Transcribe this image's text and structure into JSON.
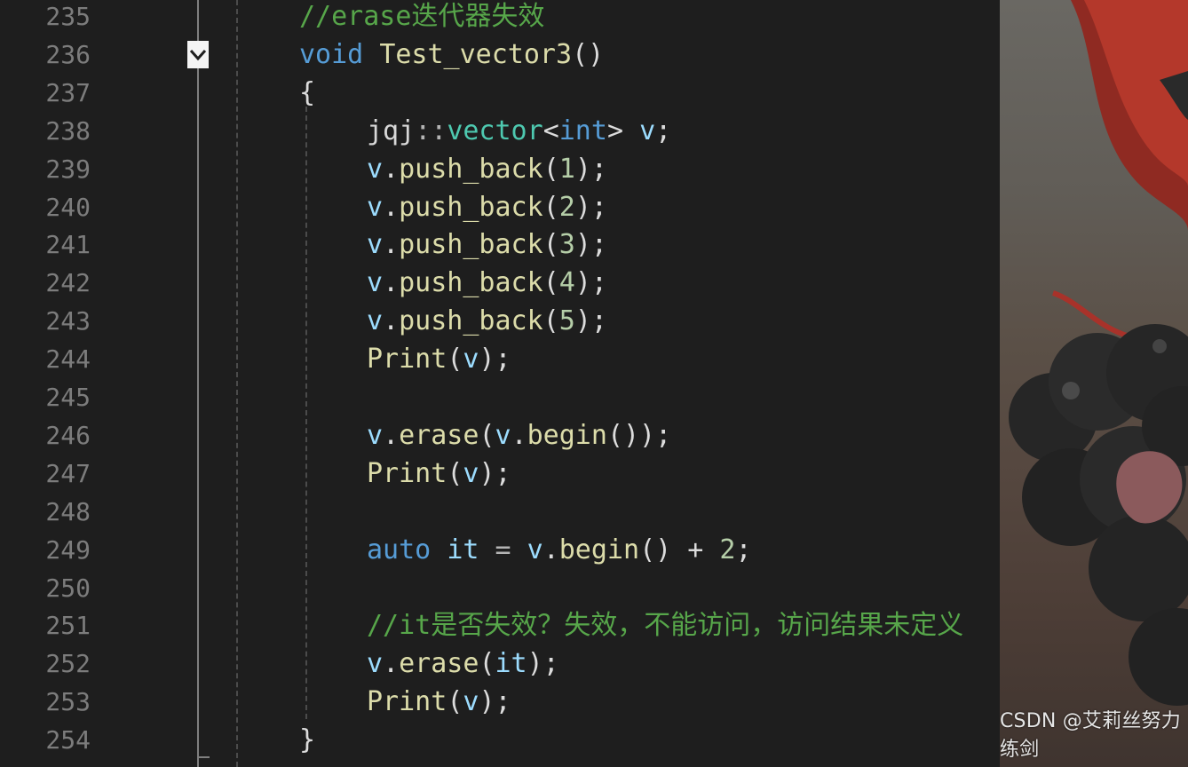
{
  "theme": {
    "background": "#1e1e1e",
    "line_number": "#7c7c7c",
    "keyword": "#569cd6",
    "type": "#4ec9b0",
    "function": "#dcdcaa",
    "variable": "#9cdcfe",
    "number": "#b5cea8",
    "comment": "#57a64a",
    "punctuation": "#dcdcdc",
    "namespace": "#d8d8d8",
    "operator": "#b4b4b4"
  },
  "editor": {
    "fold_icon": "chevron-down-icon",
    "lines": [
      {
        "num": "235",
        "indent": 0,
        "tokens": [
          {
            "t": "//erase迭代器失效",
            "k": "comment"
          }
        ]
      },
      {
        "num": "236",
        "indent": 0,
        "tokens": [
          {
            "t": "void",
            "k": "keyword"
          },
          {
            "t": " ",
            "k": "punctuation"
          },
          {
            "t": "Test_vector3",
            "k": "function"
          },
          {
            "t": "()",
            "k": "punctuation"
          }
        ]
      },
      {
        "num": "237",
        "indent": 0,
        "tokens": [
          {
            "t": "{",
            "k": "punctuation"
          }
        ]
      },
      {
        "num": "238",
        "indent": 1,
        "tokens": [
          {
            "t": "jqj",
            "k": "namespace"
          },
          {
            "t": "::",
            "k": "operator"
          },
          {
            "t": "vector",
            "k": "type"
          },
          {
            "t": "<",
            "k": "punctuation"
          },
          {
            "t": "int",
            "k": "keyword"
          },
          {
            "t": "> ",
            "k": "punctuation"
          },
          {
            "t": "v",
            "k": "variable"
          },
          {
            "t": ";",
            "k": "punctuation"
          }
        ]
      },
      {
        "num": "239",
        "indent": 1,
        "tokens": [
          {
            "t": "v",
            "k": "variable"
          },
          {
            "t": ".",
            "k": "punctuation"
          },
          {
            "t": "push_back",
            "k": "function"
          },
          {
            "t": "(",
            "k": "punctuation"
          },
          {
            "t": "1",
            "k": "number"
          },
          {
            "t": ");",
            "k": "punctuation"
          }
        ]
      },
      {
        "num": "240",
        "indent": 1,
        "tokens": [
          {
            "t": "v",
            "k": "variable"
          },
          {
            "t": ".",
            "k": "punctuation"
          },
          {
            "t": "push_back",
            "k": "function"
          },
          {
            "t": "(",
            "k": "punctuation"
          },
          {
            "t": "2",
            "k": "number"
          },
          {
            "t": ");",
            "k": "punctuation"
          }
        ]
      },
      {
        "num": "241",
        "indent": 1,
        "tokens": [
          {
            "t": "v",
            "k": "variable"
          },
          {
            "t": ".",
            "k": "punctuation"
          },
          {
            "t": "push_back",
            "k": "function"
          },
          {
            "t": "(",
            "k": "punctuation"
          },
          {
            "t": "3",
            "k": "number"
          },
          {
            "t": ");",
            "k": "punctuation"
          }
        ]
      },
      {
        "num": "242",
        "indent": 1,
        "tokens": [
          {
            "t": "v",
            "k": "variable"
          },
          {
            "t": ".",
            "k": "punctuation"
          },
          {
            "t": "push_back",
            "k": "function"
          },
          {
            "t": "(",
            "k": "punctuation"
          },
          {
            "t": "4",
            "k": "number"
          },
          {
            "t": ");",
            "k": "punctuation"
          }
        ]
      },
      {
        "num": "243",
        "indent": 1,
        "tokens": [
          {
            "t": "v",
            "k": "variable"
          },
          {
            "t": ".",
            "k": "punctuation"
          },
          {
            "t": "push_back",
            "k": "function"
          },
          {
            "t": "(",
            "k": "punctuation"
          },
          {
            "t": "5",
            "k": "number"
          },
          {
            "t": ");",
            "k": "punctuation"
          }
        ]
      },
      {
        "num": "244",
        "indent": 1,
        "tokens": [
          {
            "t": "Print",
            "k": "function"
          },
          {
            "t": "(",
            "k": "punctuation"
          },
          {
            "t": "v",
            "k": "variable"
          },
          {
            "t": ");",
            "k": "punctuation"
          }
        ]
      },
      {
        "num": "245",
        "indent": 1,
        "tokens": []
      },
      {
        "num": "246",
        "indent": 1,
        "tokens": [
          {
            "t": "v",
            "k": "variable"
          },
          {
            "t": ".",
            "k": "punctuation"
          },
          {
            "t": "erase",
            "k": "function"
          },
          {
            "t": "(",
            "k": "punctuation"
          },
          {
            "t": "v",
            "k": "variable"
          },
          {
            "t": ".",
            "k": "punctuation"
          },
          {
            "t": "begin",
            "k": "function"
          },
          {
            "t": "());",
            "k": "punctuation"
          }
        ]
      },
      {
        "num": "247",
        "indent": 1,
        "tokens": [
          {
            "t": "Print",
            "k": "function"
          },
          {
            "t": "(",
            "k": "punctuation"
          },
          {
            "t": "v",
            "k": "variable"
          },
          {
            "t": ");",
            "k": "punctuation"
          }
        ]
      },
      {
        "num": "248",
        "indent": 1,
        "tokens": []
      },
      {
        "num": "249",
        "indent": 1,
        "tokens": [
          {
            "t": "auto",
            "k": "keyword"
          },
          {
            "t": " ",
            "k": "punctuation"
          },
          {
            "t": "it",
            "k": "variable"
          },
          {
            "t": " = ",
            "k": "operator"
          },
          {
            "t": "v",
            "k": "variable"
          },
          {
            "t": ".",
            "k": "punctuation"
          },
          {
            "t": "begin",
            "k": "function"
          },
          {
            "t": "() + ",
            "k": "punctuation"
          },
          {
            "t": "2",
            "k": "number"
          },
          {
            "t": ";",
            "k": "punctuation"
          }
        ]
      },
      {
        "num": "250",
        "indent": 1,
        "tokens": []
      },
      {
        "num": "251",
        "indent": 1,
        "tokens": [
          {
            "t": "//it是否失效？失效，不能访问，访问结果未定义",
            "k": "comment"
          }
        ]
      },
      {
        "num": "252",
        "indent": 1,
        "tokens": [
          {
            "t": "v",
            "k": "variable"
          },
          {
            "t": ".",
            "k": "punctuation"
          },
          {
            "t": "erase",
            "k": "function"
          },
          {
            "t": "(",
            "k": "punctuation"
          },
          {
            "t": "it",
            "k": "variable"
          },
          {
            "t": ");",
            "k": "punctuation"
          }
        ]
      },
      {
        "num": "253",
        "indent": 1,
        "tokens": [
          {
            "t": "Print",
            "k": "function"
          },
          {
            "t": "(",
            "k": "punctuation"
          },
          {
            "t": "v",
            "k": "variable"
          },
          {
            "t": ");",
            "k": "punctuation"
          }
        ]
      },
      {
        "num": "254",
        "indent": 0,
        "tokens": [
          {
            "t": "}",
            "k": "punctuation"
          }
        ]
      }
    ]
  },
  "watermark": "CSDN @艾莉丝努力练剑"
}
